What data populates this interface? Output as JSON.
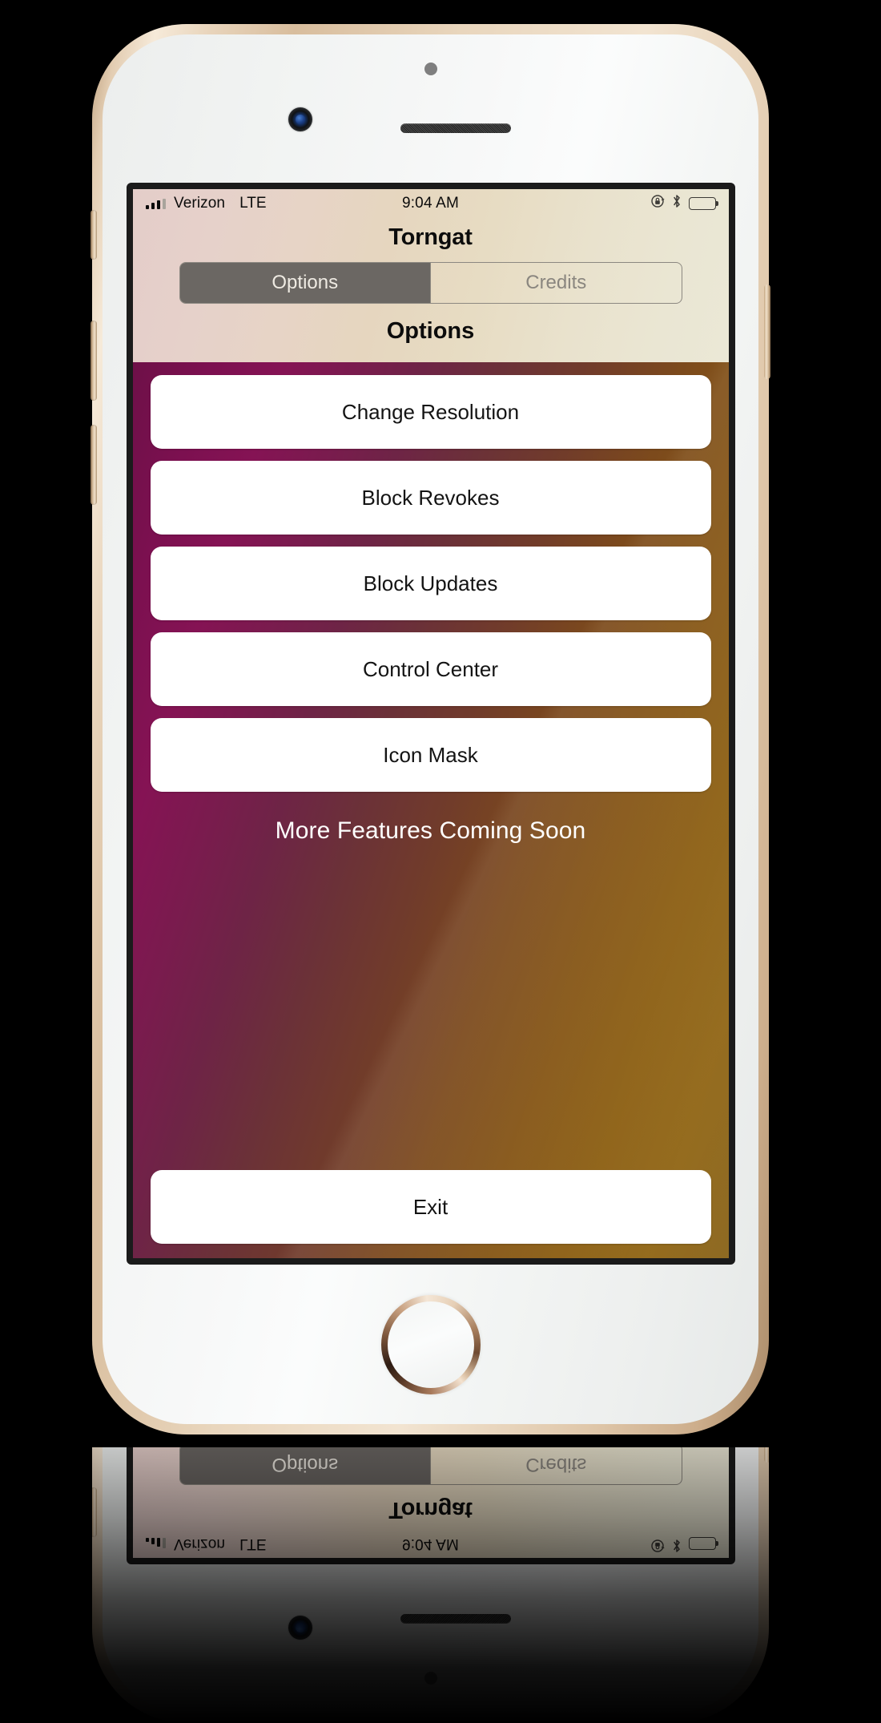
{
  "device": {
    "name": "iphone-gold-white",
    "icons": {
      "front_camera": "camera-icon",
      "earpiece": "speaker-grille-icon",
      "proximity_sensor": "sensor-dot-icon",
      "home_button": "home-button-icon",
      "mute_switch": "mute-switch-icon",
      "volume_up": "volume-up-button",
      "volume_down": "volume-down-button",
      "power": "power-button"
    }
  },
  "status_bar": {
    "signal_icon": "signal-bars-icon",
    "carrier": "Verizon",
    "network": "LTE",
    "time": "9:04 AM",
    "rotation_lock_icon": "rotation-lock-icon",
    "bluetooth_icon": "bluetooth-icon",
    "battery_icon": "battery-icon"
  },
  "app": {
    "title": "Torngat",
    "segmented_control": {
      "selected": "Options",
      "options": [
        {
          "label": "Options",
          "active": true
        },
        {
          "label": "Credits",
          "active": false
        }
      ]
    },
    "section_title": "Options",
    "menu_items": [
      {
        "label": "Change Resolution"
      },
      {
        "label": "Block Revokes"
      },
      {
        "label": "Block Updates"
      },
      {
        "label": "Control Center"
      },
      {
        "label": "Icon Mask"
      }
    ],
    "coming_soon_text": "More Features Coming Soon",
    "exit_label": "Exit"
  },
  "colors": {
    "header_gradient_start": "#e4cdc9",
    "header_gradient_end": "#ebe8d6",
    "body_gradient_start": "#6e1048",
    "body_gradient_mid": "#713c2a",
    "body_gradient_end": "#8e6a23",
    "segment_active_fill": "#6b6763",
    "segment_active_text": "#eeeae2",
    "segment_inactive_text": "#8a867f",
    "button_fill": "#ffffff",
    "button_text": "#141414",
    "coming_soon_text_color": "#ffffff",
    "backdrop": "#000000"
  }
}
